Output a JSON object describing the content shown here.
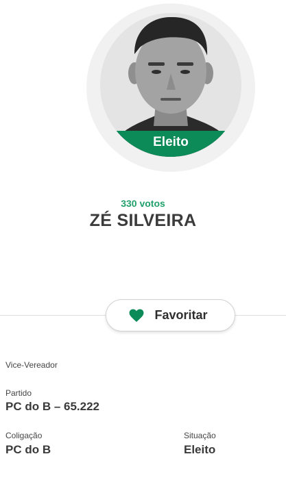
{
  "candidate": {
    "status_badge": "Eleito",
    "votes": "330 votos",
    "name": "ZÉ SILVEIRA"
  },
  "actions": {
    "favorite_label": "Favoritar"
  },
  "details": {
    "role": "Vice-Vereador",
    "party_label": "Partido",
    "party_value": "PC do B – 65.222",
    "coalition_label": "Coligação",
    "coalition_value": "PC do B",
    "situation_label": "Situação",
    "situation_value": "Eleito"
  },
  "colors": {
    "accent_green": "#0c8a57",
    "votes_green": "#20a06a"
  },
  "icons": {
    "favorite": "heart-icon"
  }
}
